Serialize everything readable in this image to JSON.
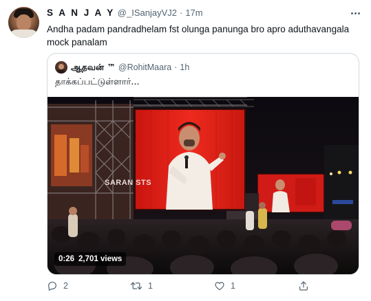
{
  "tweet": {
    "display_name": "S A N J A Y",
    "handle": "@_ISanjayVJ2",
    "separator": "·",
    "time": "17m",
    "text": "Andha padam pandradhelam fst olunga panunga bro apro aduthavangala mock panalam"
  },
  "quote": {
    "display_name": "ஆதவன் ™",
    "handle": "@RohitMaara",
    "separator": "·",
    "time": "1h",
    "text": "தாக்கப்பட்டுள்ளார்...",
    "video": {
      "watermark": "SARAN STS",
      "duration": "0:26",
      "views": "2,701 views"
    }
  },
  "actions": {
    "replies": "2",
    "retweets": "1",
    "likes": "1"
  },
  "colors": {
    "text_primary": "#0f1419",
    "text_secondary": "#536471",
    "border": "#cfd9de",
    "screen_red": "#e8231c"
  },
  "icons": {
    "more": "more-icon",
    "reply": "reply-icon",
    "retweet": "retweet-icon",
    "like": "heart-icon",
    "share": "share-icon"
  }
}
